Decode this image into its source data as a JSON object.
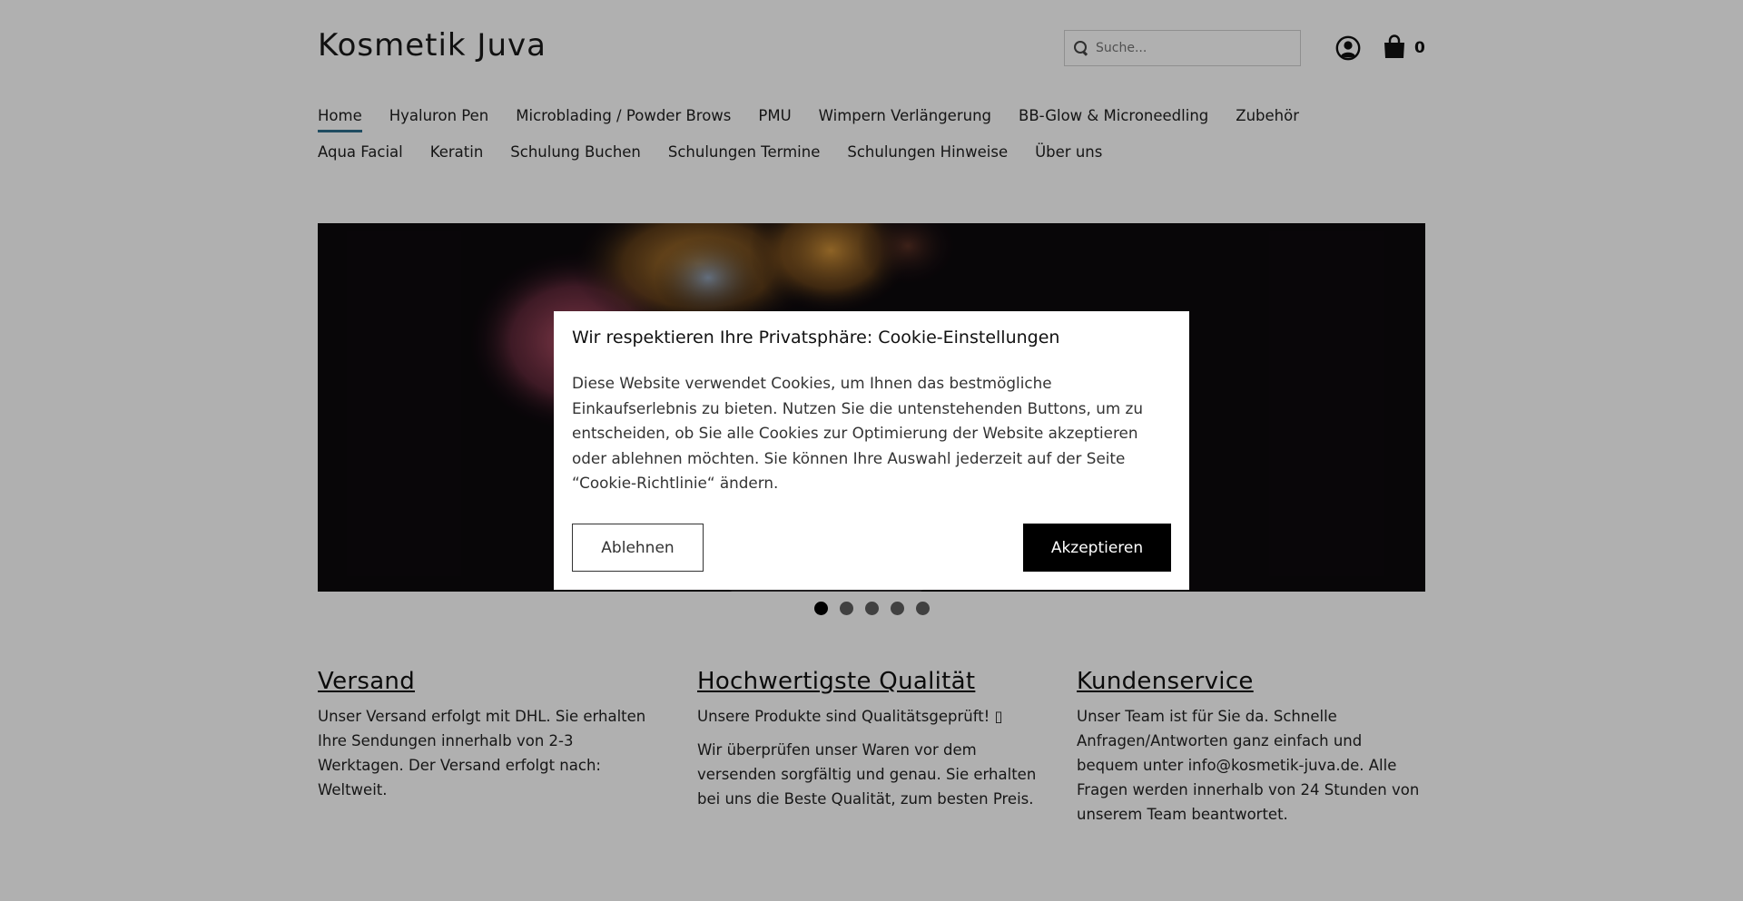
{
  "header": {
    "brand": "Kosmetik Juva",
    "search_placeholder": "Suche...",
    "cart_count": "0"
  },
  "nav": {
    "row1": [
      "Home",
      "Hyaluron Pen",
      "Microblading / Powder Brows",
      "PMU",
      "Wimpern Verlängerung",
      "BB-Glow & Microneedling",
      "Zubehör"
    ],
    "row2": [
      "Aqua Facial",
      "Keratin",
      "Schulung Buchen",
      "Schulungen Termine",
      "Schulungen Hinweise",
      "Über uns"
    ],
    "active": "Home"
  },
  "slider": {
    "total": 5,
    "active_index": 0
  },
  "features": [
    {
      "title": "Versand",
      "paragraphs": [
        "Unser Versand erfolgt mit DHL. Sie erhalten Ihre Sendungen innerhalb von 2-3 Werktagen. Der Versand erfolgt nach: Weltweit."
      ]
    },
    {
      "title": "Hochwertigste Qualität",
      "paragraphs": [
        "Unsere Produkte sind Qualitätsgeprüft! ▯",
        "Wir überprüfen unser Waren vor dem versenden sorgfältig und genau. Sie erhalten bei uns die Beste Qualität, zum besten Preis."
      ]
    },
    {
      "title": "Kundenservice",
      "paragraphs": [
        "Unser Team ist für Sie da. Schnelle Anfragen/Antworten ganz einfach und bequem unter info@kosmetik-juva.de. Alle Fragen werden innerhalb von 24 Stunden von unserem Team beantwortet."
      ]
    }
  ],
  "cookie": {
    "title": "Wir respektieren Ihre Privatsphäre: Cookie-Einstellungen",
    "body": "Diese Website verwendet Cookies, um Ihnen das bestmögliche Einkaufserlebnis zu bieten. Nutzen Sie die untenstehenden Buttons, um zu entscheiden, ob Sie alle Cookies zur Optimierung der Website akzeptieren oder ablehnen möchten. Sie können Ihre Auswahl jederzeit auf der Seite “Cookie-Richtlinie“ ändern.",
    "decline_label": "Ablehnen",
    "accept_label": "Akzeptieren"
  },
  "colors": {
    "nav_active_underline": "#2d6f8d",
    "accept_button": "#000000",
    "hero_background": "#0d090d"
  }
}
